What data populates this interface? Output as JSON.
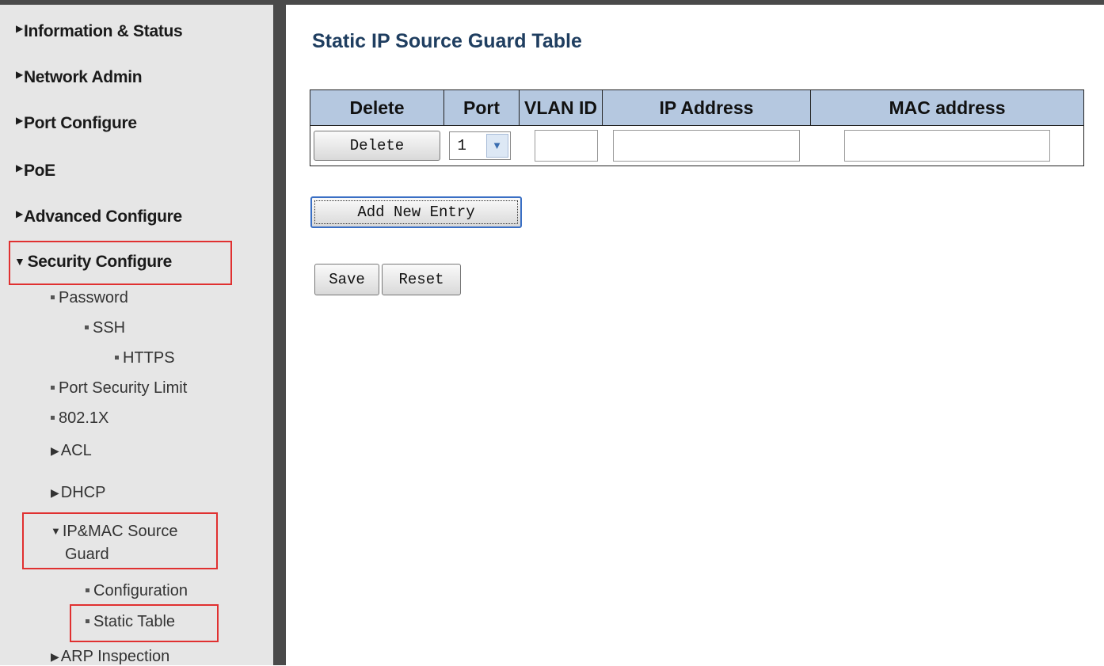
{
  "sidebar": {
    "items": [
      {
        "label": "Information & Status"
      },
      {
        "label": "Network Admin"
      },
      {
        "label": "Port Configure"
      },
      {
        "label": "PoE"
      },
      {
        "label": "Advanced Configure"
      },
      {
        "label": "Security Configure"
      }
    ],
    "security_sub": {
      "password": "Password",
      "ssh": "SSH",
      "https": "HTTPS",
      "port_security_limit": "Port Security Limit",
      "dot1x": "802.1X",
      "acl": "ACL",
      "dhcp": "DHCP",
      "ip_mac_source_guard_line1": "IP&MAC Source",
      "ip_mac_source_guard_line2": "Guard",
      "configuration": "Configuration",
      "static_table": "Static Table",
      "arp_inspection": "ARP Inspection"
    }
  },
  "main": {
    "title": "Static IP Source Guard Table",
    "table": {
      "headers": [
        "Delete",
        "Port",
        "VLAN ID",
        "IP Address",
        "MAC address"
      ],
      "row": {
        "delete_label": "Delete",
        "port_value": "1",
        "vlan_id": "",
        "ip_address": "",
        "mac_address": ""
      }
    },
    "add_new_entry_label": "Add New Entry",
    "save_label": "Save",
    "reset_label": "Reset"
  },
  "colors": {
    "title": "#1f3e60",
    "table_header_bg": "#b5c8e0",
    "sidebar_bg": "#e6e6e6",
    "highlight": "#e03030"
  }
}
